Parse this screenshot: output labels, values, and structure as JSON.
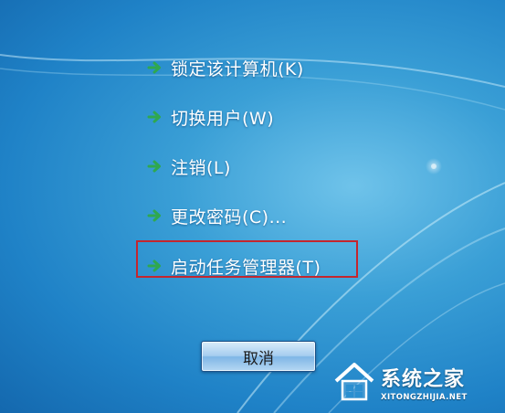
{
  "menu": {
    "items": [
      {
        "label": "锁定该计算机(K)",
        "icon": "green-arrow-icon"
      },
      {
        "label": "切换用户(W)",
        "icon": "green-arrow-icon"
      },
      {
        "label": "注销(L)",
        "icon": "green-arrow-icon"
      },
      {
        "label": "更改密码(C)...",
        "icon": "green-arrow-icon"
      },
      {
        "label": "启动任务管理器(T)",
        "icon": "green-arrow-icon",
        "highlighted": true
      }
    ]
  },
  "cancel_button": {
    "label": "取消"
  },
  "watermark": {
    "title": "系统之家",
    "url": "XITONGZHIJIA.NET"
  },
  "colors": {
    "background": "#3a9fd6",
    "arrow": "#2fa84f",
    "highlight_border": "#c4262e",
    "label": "#ffffff"
  }
}
